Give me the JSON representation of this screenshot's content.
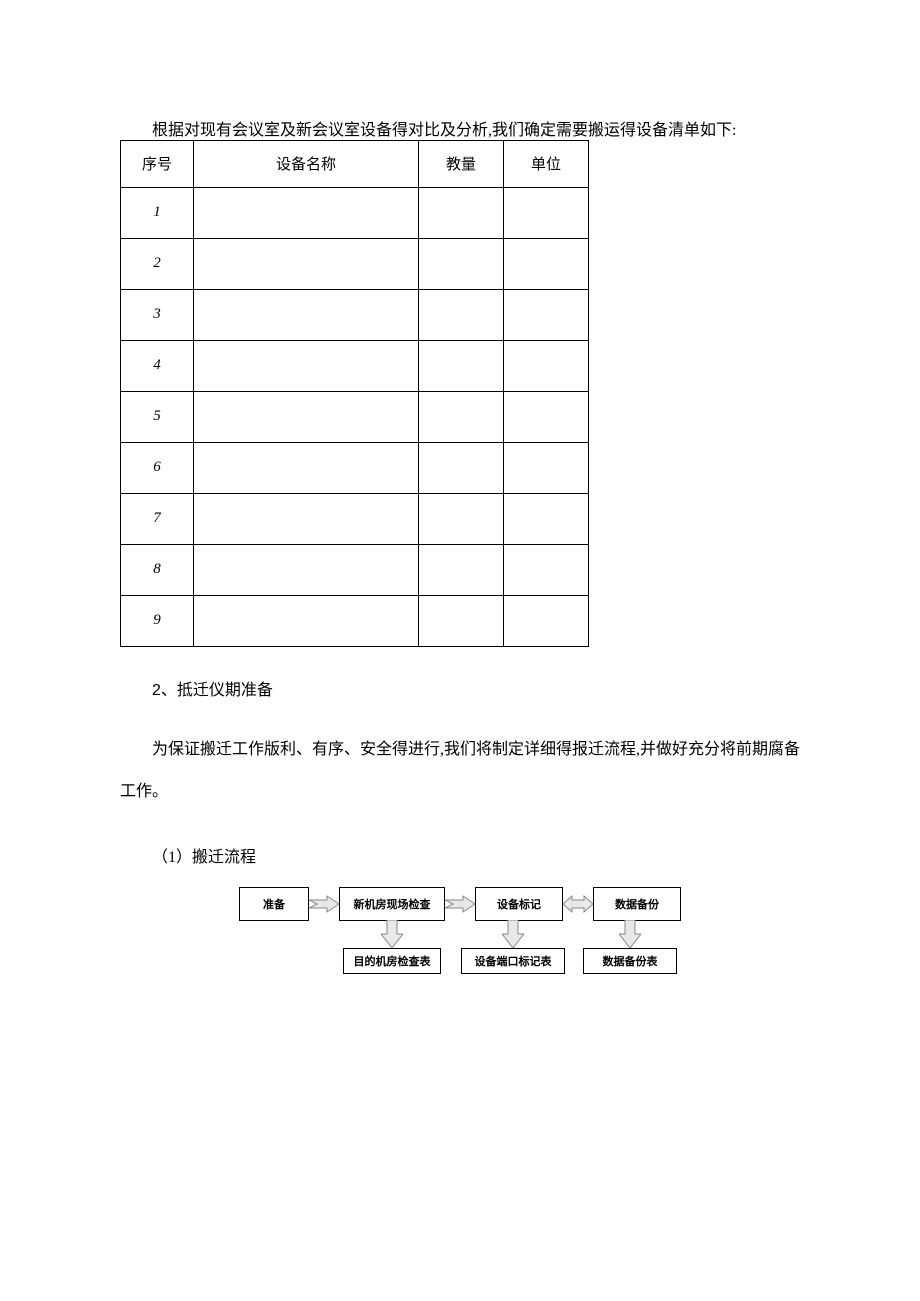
{
  "intro_para": "根据对现有会议室及新会议室设备得对比及分析,我们确定需要搬运得设备清单如下:",
  "table": {
    "headers": {
      "seq": "序号",
      "name": "设备名称",
      "qty": "教量",
      "unit": "单位"
    },
    "rows": [
      {
        "seq": "1",
        "name": "",
        "qty": "",
        "unit": ""
      },
      {
        "seq": "2",
        "name": "",
        "qty": "",
        "unit": ""
      },
      {
        "seq": "3",
        "name": "",
        "qty": "",
        "unit": ""
      },
      {
        "seq": "4",
        "name": "",
        "qty": "",
        "unit": ""
      },
      {
        "seq": "5",
        "name": "",
        "qty": "",
        "unit": ""
      },
      {
        "seq": "6",
        "name": "",
        "qty": "",
        "unit": ""
      },
      {
        "seq": "7",
        "name": "",
        "qty": "",
        "unit": ""
      },
      {
        "seq": "8",
        "name": "",
        "qty": "",
        "unit": ""
      },
      {
        "seq": "9",
        "name": "",
        "qty": "",
        "unit": ""
      }
    ]
  },
  "section2_num": "2",
  "section2_title": "、抵迁仪期准备",
  "section2_para": "为保证搬迁工作版利、有序、安全得进行,我们将制定详细得报迁流程,并做好充分将前期腐备工作。",
  "sub1_title": "（1）搬迁流程",
  "flow": {
    "top": {
      "prepare": "准备",
      "inspect": "新机房现场检查",
      "mark": "设备标记",
      "backup": "数据备份"
    },
    "bottom": {
      "check": "目的机房检查表",
      "port": "设备端口标记表",
      "bkup": "数据备份表"
    }
  }
}
